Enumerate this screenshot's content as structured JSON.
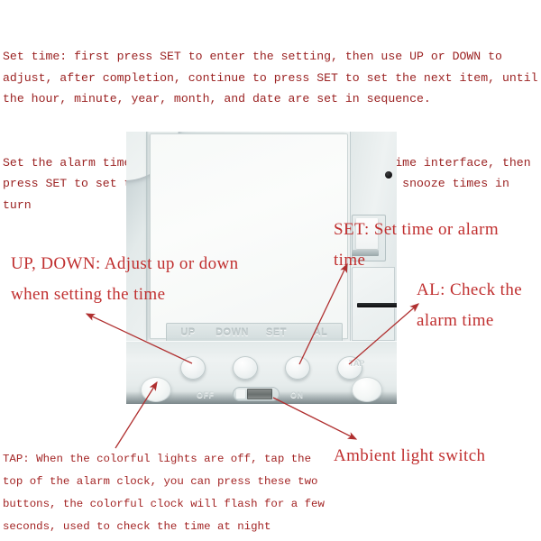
{
  "instructions": {
    "paragraph1": "Set time: first press SET to enter the setting, then use UP or DOWN to adjust, after completion, continue to press SET to set the next item, until the hour, minute, year, month, and date are set in sequence.",
    "paragraph2": "Set the alarm time: first press AL to enter the alarm time interface, then press SET to set the hour, minute, snooze interval, and snooze times in turn"
  },
  "callouts": {
    "up_down": "UP, DOWN: Adjust up or down\nwhen setting the time",
    "set": "SET: Set time or alarm\ntime",
    "al": "AL: Check the\nalarm time",
    "ambient": "Ambient light switch",
    "tap": "TAP: When the colorful lights are off, tap the top of the alarm clock, you can press these two buttons, the colorful clock will flash for a few seconds, used to check the time at night"
  },
  "device": {
    "button_labels": [
      "UP",
      "DOWN",
      "SET",
      "AL"
    ],
    "switch_off_label": "OFF",
    "switch_on_label": "ON",
    "tap_label": "TAP"
  },
  "colors": {
    "instruction_text": "#9b2222",
    "callout_text": "#c02f2f",
    "tap_note_text": "#a32424",
    "leader_line": "#b03030",
    "page_background": "#ffffff"
  }
}
